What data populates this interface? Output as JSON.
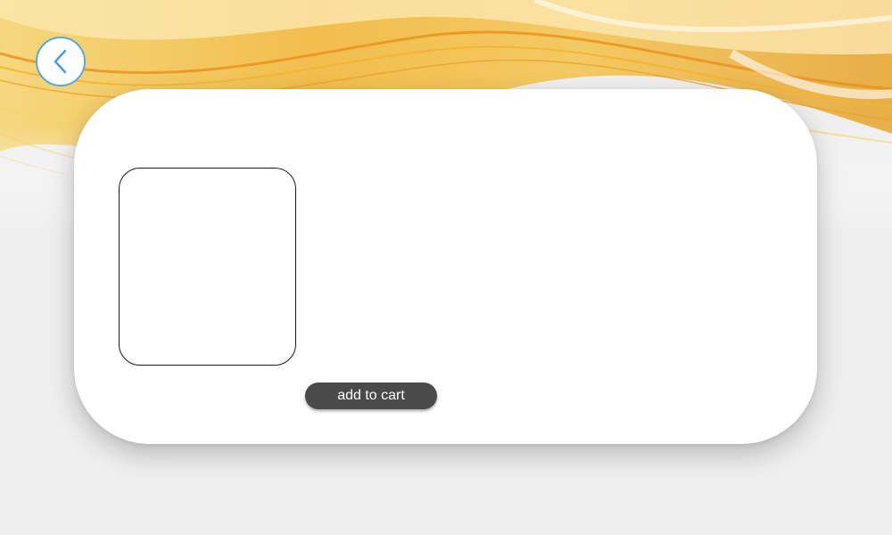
{
  "header": {
    "back_icon": "chevron-left-icon"
  },
  "product": {
    "add_to_cart_label": "add to cart"
  },
  "colors": {
    "background": "#efefef",
    "wave_gold": "#f0b429",
    "wave_orange": "#e8901a",
    "back_button_border": "#5aa9d8",
    "button_dark": "#4a4a4a"
  }
}
